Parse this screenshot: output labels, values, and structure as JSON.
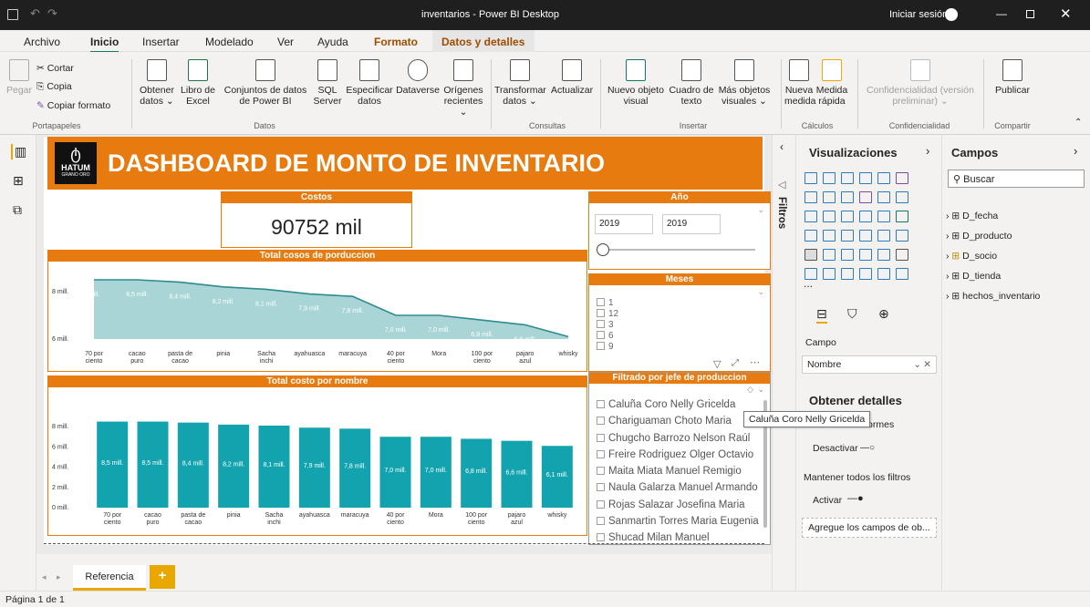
{
  "window": {
    "title": "inventarios - Power BI Desktop",
    "signin": "Iniciar sesión"
  },
  "tabs": [
    "Archivo",
    "Inicio",
    "Insertar",
    "Modelado",
    "Ver",
    "Ayuda",
    "Formato",
    "Datos y detalles"
  ],
  "ribbon": {
    "clipboard": {
      "pegar": "Pegar",
      "cortar": "Cortar",
      "copia": "Copia",
      "copiar_formato": "Copiar formato",
      "group": "Portapapeles"
    },
    "datos": {
      "group": "Datos",
      "items": [
        "Obtener datos ⌄",
        "Libro de Excel",
        "Conjuntos de datos de Power BI",
        "SQL Server",
        "Especificar datos",
        "Dataverse",
        "Orígenes recientes ⌄"
      ]
    },
    "consultas": {
      "group": "Consultas",
      "items": [
        "Transformar datos ⌄",
        "Actualizar"
      ]
    },
    "insertar": {
      "group": "Insertar",
      "items": [
        "Nuevo objeto visual",
        "Cuadro de texto",
        "Más objetos visuales ⌄"
      ]
    },
    "calculos": {
      "group": "Cálculos",
      "items": [
        "Nueva medida",
        "Medida rápida"
      ]
    },
    "confidencialidad": {
      "group": "Confidencialidad",
      "items": [
        "Confidencialidad (versión preliminar) ⌄"
      ]
    },
    "compartir": {
      "group": "Compartir",
      "items": [
        "Publicar"
      ]
    }
  },
  "dashboard": {
    "logo": "HATUM",
    "logo_sub": "GRANO ORO",
    "title": "DASHBOARD DE MONTO DE INVENTARIO",
    "costos_label": "Costos",
    "costos_value": "90752 mil",
    "anio_label": "Año",
    "anio_from": "2019",
    "anio_to": "2019",
    "meses_label": "Meses",
    "meses": [
      "1",
      "12",
      "3",
      "6",
      "9"
    ],
    "jefe_label": "Filtrado por jefe de produccion",
    "jefes": [
      "Caluña Coro Nelly Gricelda",
      "Chariguaman Choto Maria",
      "Chugcho Barrozo Nelson Raúl",
      "Freire Rodriguez Olger Octavio",
      "Maita Miata Manuel Remigio",
      "Naula Galarza Manuel Armando",
      "Rojas Salazar Josefina Maria",
      "Sanmartin Torres Maria Eugenia",
      "Shucad Milan Manuel"
    ],
    "tooltip": "Caluña Coro Nelly Gricelda"
  },
  "chart_data": [
    {
      "type": "area",
      "title": "Total cosos de porduccion",
      "categories": [
        "70 por ciento",
        "cacao puro",
        "pasta de cacao",
        "pinia",
        "Sacha inchi",
        "ayahuasca",
        "maracuya",
        "40 por ciento",
        "Mora",
        "100 por ciento",
        "pajaro azul",
        "whisky"
      ],
      "values": [
        8.5,
        8.5,
        8.4,
        8.2,
        8.1,
        7.9,
        7.8,
        7.0,
        7.0,
        6.8,
        6.6,
        6.1
      ],
      "data_labels": [
        "mill.",
        "8,5 mill.",
        "8,4 mill.",
        "8,2 mill.",
        "8,1 mill.",
        "7,9 mill.",
        "7,8 mill.",
        "7,0 mill.",
        "7,0 mill.",
        "6,8 mill.",
        "6,6 mill.",
        ""
      ],
      "yticks": [
        "8 mill.",
        "6 mill."
      ],
      "ylim": [
        6,
        8.5
      ]
    },
    {
      "type": "bar",
      "title": "Total costo por nombre",
      "categories": [
        "70 por ciento",
        "cacao puro",
        "pasta de cacao",
        "pinia",
        "Sacha inchi",
        "ayahuasca",
        "maracuya",
        "40 por ciento",
        "Mora",
        "100 por ciento",
        "pajaro azul",
        "whisky"
      ],
      "values": [
        8.5,
        8.5,
        8.4,
        8.2,
        8.1,
        7.9,
        7.8,
        7.0,
        7.0,
        6.8,
        6.6,
        6.1
      ],
      "data_labels": [
        "8,5 mill.",
        "8,5 mill.",
        "8,4 mill.",
        "8,2 mill.",
        "8,1 mill.",
        "7,9 mill.",
        "7,8 mill.",
        "7,0 mill.",
        "7,0 mill.",
        "6,8 mill.",
        "6,6 mill.",
        "6,1 mill."
      ],
      "yticks": [
        "8 mill.",
        "6 mill.",
        "4 mill.",
        "2 mill.",
        "0 mill."
      ],
      "ylim": [
        0,
        9
      ]
    }
  ],
  "pages": {
    "tab": "Referencia",
    "add": "+",
    "status": "Página 1 de 1"
  },
  "filters": {
    "label": "Filtros"
  },
  "viz": {
    "title": "Visualizaciones",
    "campo_label": "Campo",
    "campo_value": "Nombre",
    "detalles_title": "Obtener detalles",
    "tooltip_partial": "Entre varios informes",
    "desactivar": "Desactivar",
    "mantener": "Mantener todos los filtros",
    "activar": "Activar",
    "agregue": "Agregue los campos de ob...",
    "more": "..."
  },
  "fields": {
    "title": "Campos",
    "search": "Buscar",
    "tables": [
      "D_fecha",
      "D_producto",
      "D_socio",
      "D_tienda",
      "hechos_inventario"
    ]
  }
}
